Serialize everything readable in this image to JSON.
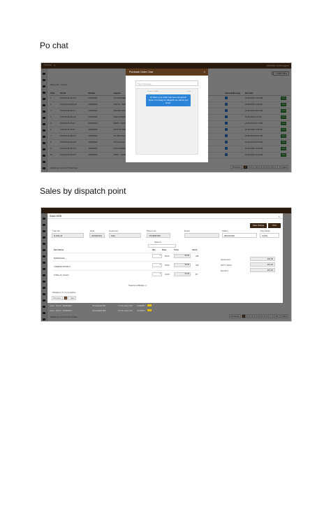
{
  "sections": [
    {
      "heading": "Po chat",
      "app": {
        "brand": "Vishnu",
        "user": "Member User",
        "logout": "Logout",
        "add_button": "+ Add New",
        "show_entries": "Show 10 ↓ entries",
        "columns": [
          "Sl No",
          "PO No",
          "PO Date",
          "Supplier",
          "",
          "Inbound Message",
          "Due Date",
          ""
        ],
        "rows": [
          {
            "no": "1",
            "po": "PUR-00-24-419-15",
            "date": "22/08/2024",
            "supplier": "A.M.S ENTERPRISE - MUMBAI",
            "note": "go Items",
            "due": "23-08-2024 17:09 AM"
          },
          {
            "no": "2",
            "po": "PUR-00-24-NHN-16",
            "date": "22/08/2024",
            "supplier": "SOUTH - BHIWANDI-PUNE",
            "note": "go Items",
            "due": "25-08-2024 11:49 AM"
          },
          {
            "no": "3",
            "po": "PUR-00-24-419-17",
            "date": "21/08/2024",
            "supplier": "SHIVAM GUPTA MFG",
            "note": "go Items",
            "due": "25-08-2024 16:02 AM"
          },
          {
            "no": "4",
            "po": "PUR-00-24-419-18",
            "date": "21/08/2024",
            "supplier": "RAM TRADERS & BROKERAGE",
            "note": "go Items",
            "due": "21-08-2024 1:15 AM"
          },
          {
            "no": "5",
            "po": "PUR-00-24-74-10",
            "date": "20/08/2024",
            "supplier": "DUDU - NAVSHIVAVIRAN",
            "note": "go Items",
            "due": "21-08-2024 10:17 AM"
          },
          {
            "no": "6",
            "po": "PUR-00-24-79-16",
            "date": "20/08/2024",
            "supplier": "SAKTI ENTERPRISES",
            "note": "go Items",
            "due": "20-08-2024 11:25 AM"
          },
          {
            "no": "7",
            "po": "PUR-00-24-41M-17",
            "date": "19/08/2024",
            "supplier": "Sun Merchant Minerals",
            "note": "go Items",
            "due": "20-08-2024 10:51 AM"
          },
          {
            "no": "8",
            "po": "PUR-00-24-419-18",
            "date": "19/08/2024",
            "supplier": "S.R.Industries - Gurgaon",
            "note": "go Items",
            "due": "19-08-2024 10:53 AM"
          },
          {
            "no": "9",
            "po": "PUR-00-24-419-19",
            "date": "19/08/2024",
            "supplier": "RAM TRADERS & BROKERAGE",
            "note": "go Items",
            "due": "19-08-2024 14:25 AM"
          },
          {
            "no": "10",
            "po": "PUR-00-24-419-20",
            "date": "19/08/2024",
            "supplier": "DUDU - CHAMARAJNAGAR",
            "note": "go Items",
            "due": "19-08-2024 14:25 AM"
          }
        ],
        "view_label": "View",
        "footer_info": "Showing 1 to 10 of 70 entries",
        "pager": [
          "Previous",
          "1",
          "2",
          "3",
          "4",
          "5",
          "6",
          "7",
          "Next"
        ],
        "modal": {
          "title": "Purchase Order Chat",
          "close": "×",
          "placeholder": "Type Message...",
          "meta_left": "Vishnu 1:11 AM",
          "meta_right": "Sent",
          "message": "Hi Team your order has been accepted. Since it is ready for dispatch we will let you know."
        }
      }
    },
    {
      "heading": "Sales by dispatch point",
      "app": {
        "modal": {
          "title": "Sales WEB",
          "close": "×",
          "save": "Save change",
          "print": "Print",
          "fields": [
            {
              "label": "Tran No",
              "value": "S-WD-42"
            },
            {
              "label": "Date",
              "value": "20/08/2024"
            },
            {
              "label": "Customer",
              "value": "Dilip"
            },
            {
              "label": "Phone No",
              "value": "7234896789"
            },
            {
              "label": "Email",
              "value": ""
            },
            {
              "label": "Status",
              "value": "RECEIVED"
            },
            {
              "label": "Pay Mode",
              "value": "CASH"
            }
          ],
          "search_label": "Search:",
          "item_headers": [
            "Item Name",
            "Qty",
            "Rate",
            "Total",
            "Stock"
          ],
          "items": [
            {
              "name": "MARKHSIAL",
              "qty": "1",
              "rate": "56.00",
              "total": "56.00",
              "stock": "236"
            },
            {
              "name": "CHEESE MOSALA",
              "qty": "1",
              "rate": "35.00",
              "total": "35.00",
              "stock": "100"
            },
            {
              "name": "Coffee-itl, sweets",
              "qty": "1",
              "rate": "41.00",
              "total": "41.00",
              "stock": "36"
            }
          ],
          "total_nos": "Total No of Bottles: 4",
          "summary": [
            {
              "label": "Gross Amt",
              "value": "132.00"
            },
            {
              "label": "GST ( 12%)",
              "value": "101.20"
            },
            {
              "label": "Net Amt",
              "value": "101.20"
            }
          ],
          "showing": "Showing 1 to 3 of 3 entries",
          "pager": [
            "Previous",
            "1",
            "Next"
          ]
        },
        "bg_rows": [
          {
            "a": "Jasmi",
            "b": "PQ-20",
            "c": "26/08/2024",
            "d": "Ahmedabad 945",
            "e": "S-X-S-1-Dec-V15",
            "f": "CGSDRM"
          },
          {
            "a": "Jason",
            "b": "PQ-22",
            "c": "22/08/2024",
            "d": "Ahmedabad 945",
            "e": "S-X-S-1-Dec-V15",
            "f": "CGSDRM"
          }
        ],
        "footer_info": "Showing 1 to 10 of 16 entries",
        "pager": [
          "Previous",
          "1",
          "2",
          "3",
          "4",
          "5",
          "...",
          "10",
          "Next"
        ]
      }
    }
  ]
}
